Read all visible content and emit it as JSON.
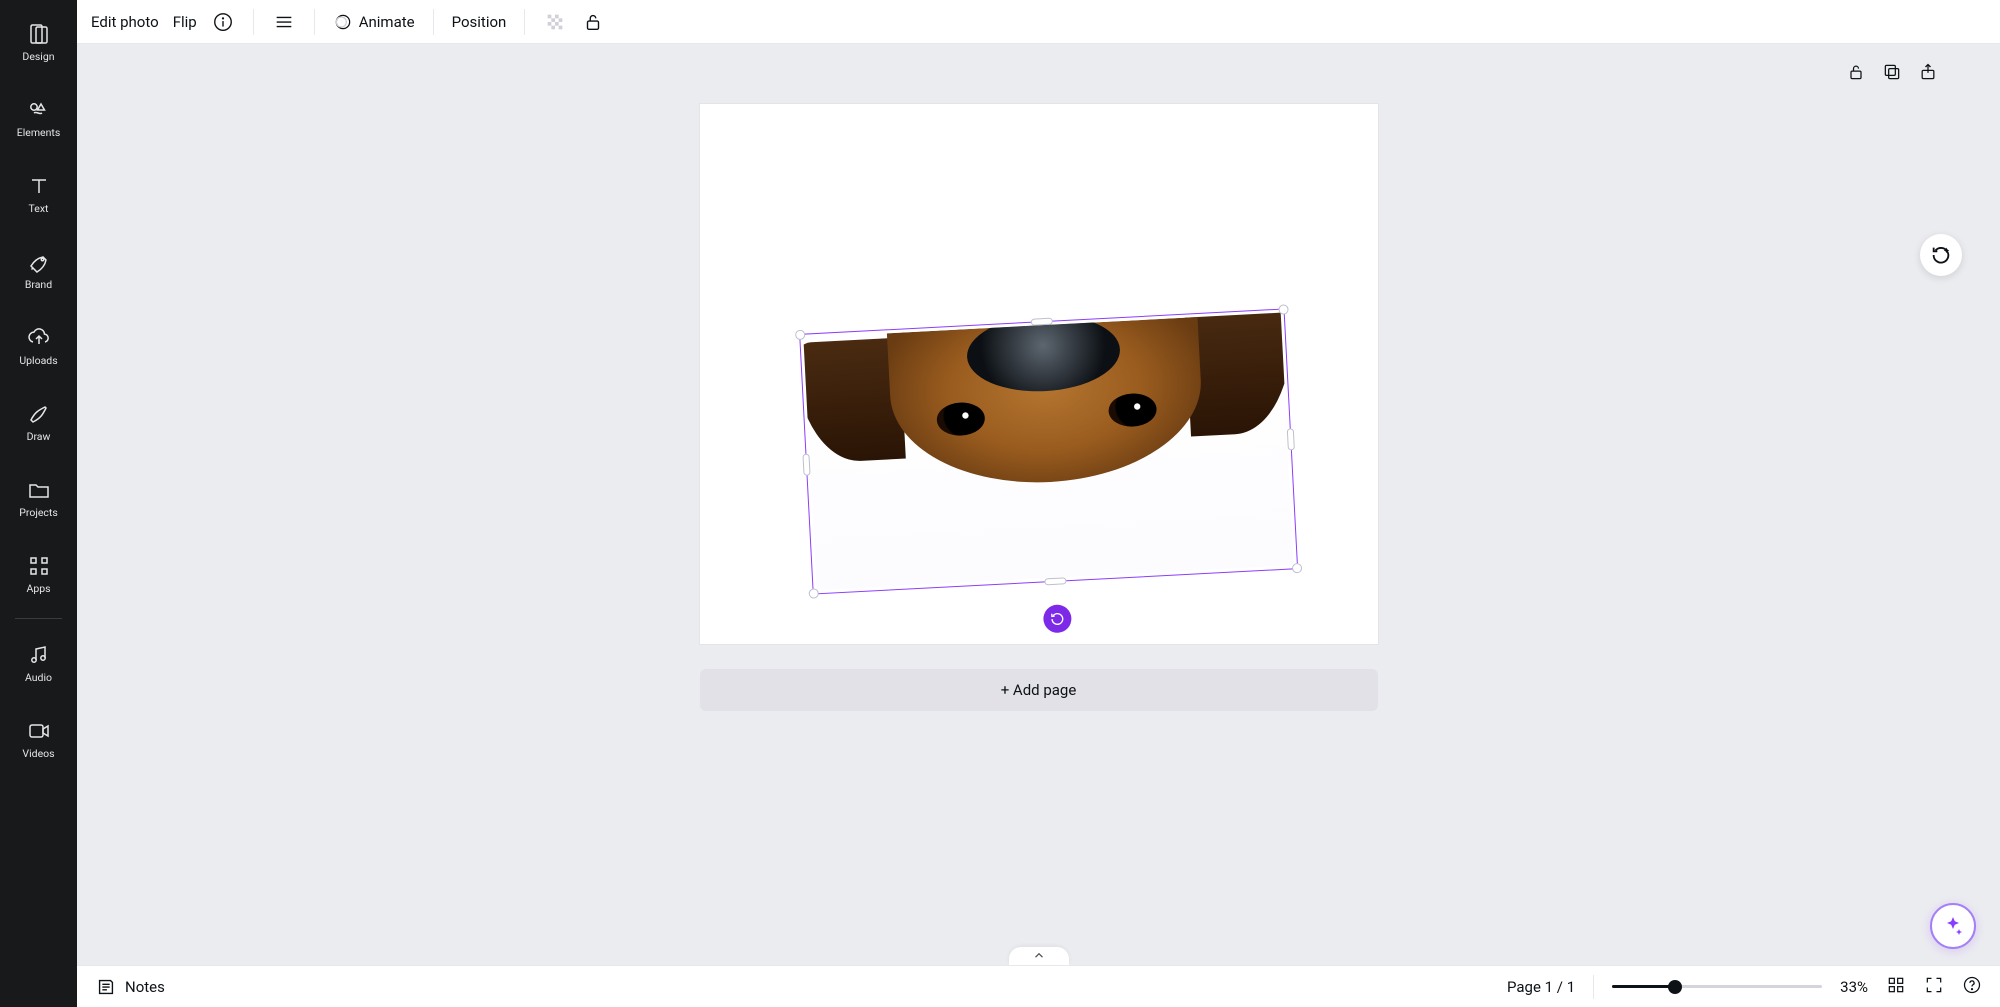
{
  "sidebar": {
    "items": [
      {
        "id": "design",
        "label": "Design"
      },
      {
        "id": "elements",
        "label": "Elements"
      },
      {
        "id": "text",
        "label": "Text"
      },
      {
        "id": "brand",
        "label": "Brand"
      },
      {
        "id": "uploads",
        "label": "Uploads"
      },
      {
        "id": "draw",
        "label": "Draw"
      },
      {
        "id": "projects",
        "label": "Projects"
      },
      {
        "id": "apps",
        "label": "Apps"
      },
      {
        "id": "audio",
        "label": "Audio"
      },
      {
        "id": "videos",
        "label": "Videos"
      }
    ]
  },
  "context_toolbar": {
    "edit_photo": "Edit photo",
    "flip": "Flip",
    "animate": "Animate",
    "position": "Position"
  },
  "canvas": {
    "add_page_label": "+ Add page",
    "selected_element": {
      "type": "photo",
      "rotation_deg": -3
    }
  },
  "status_bar": {
    "notes_label": "Notes",
    "page_indicator": "Page 1 / 1",
    "zoom_percent": "33%",
    "zoom_slider_value": 33
  }
}
